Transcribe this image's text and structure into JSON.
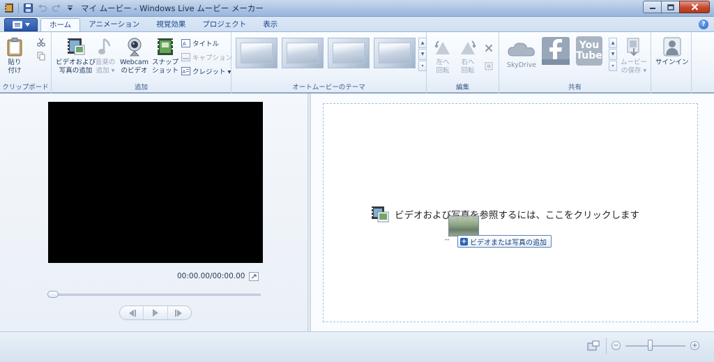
{
  "window": {
    "title": "マイ ムービー - Windows Live ムービー メーカー"
  },
  "tabs": [
    "ホーム",
    "アニメーション",
    "視覚効果",
    "プロジェクト",
    "表示"
  ],
  "ribbon": {
    "clipboard": {
      "paste_label": "貼り\n付け",
      "group_label": "クリップボード"
    },
    "add": {
      "add_media_label": "ビデオおよび\n写真の追加",
      "add_music_label": "音楽の\n追加 ▾",
      "webcam_label": "Webcam\nのビデオ",
      "snapshot_label": "スナップ\nショット",
      "title_label": "タイトル",
      "caption_label": "キャプション",
      "credits_label": "クレジット ▾",
      "group_label": "追加"
    },
    "automovie": {
      "group_label": "オートムービーのテーマ"
    },
    "edit": {
      "rotate_left_label": "左へ\n回転",
      "rotate_right_label": "右へ\n回転",
      "group_label": "編集"
    },
    "share": {
      "skydrive_label": "SkyDrive",
      "youtube_label": "You\nTube",
      "save_movie_label": "ムービー\nの保存 ▾",
      "group_label": "共有"
    },
    "signin": {
      "signin_label": "サインイン"
    }
  },
  "preview": {
    "timecode": "00:00.00/00:00.00"
  },
  "storyboard": {
    "prompt": "ビデオおよび写真を参照するには、ここをクリックします",
    "drag_marker": "--",
    "add_tooltip": "ビデオまたは写真の追加"
  }
}
